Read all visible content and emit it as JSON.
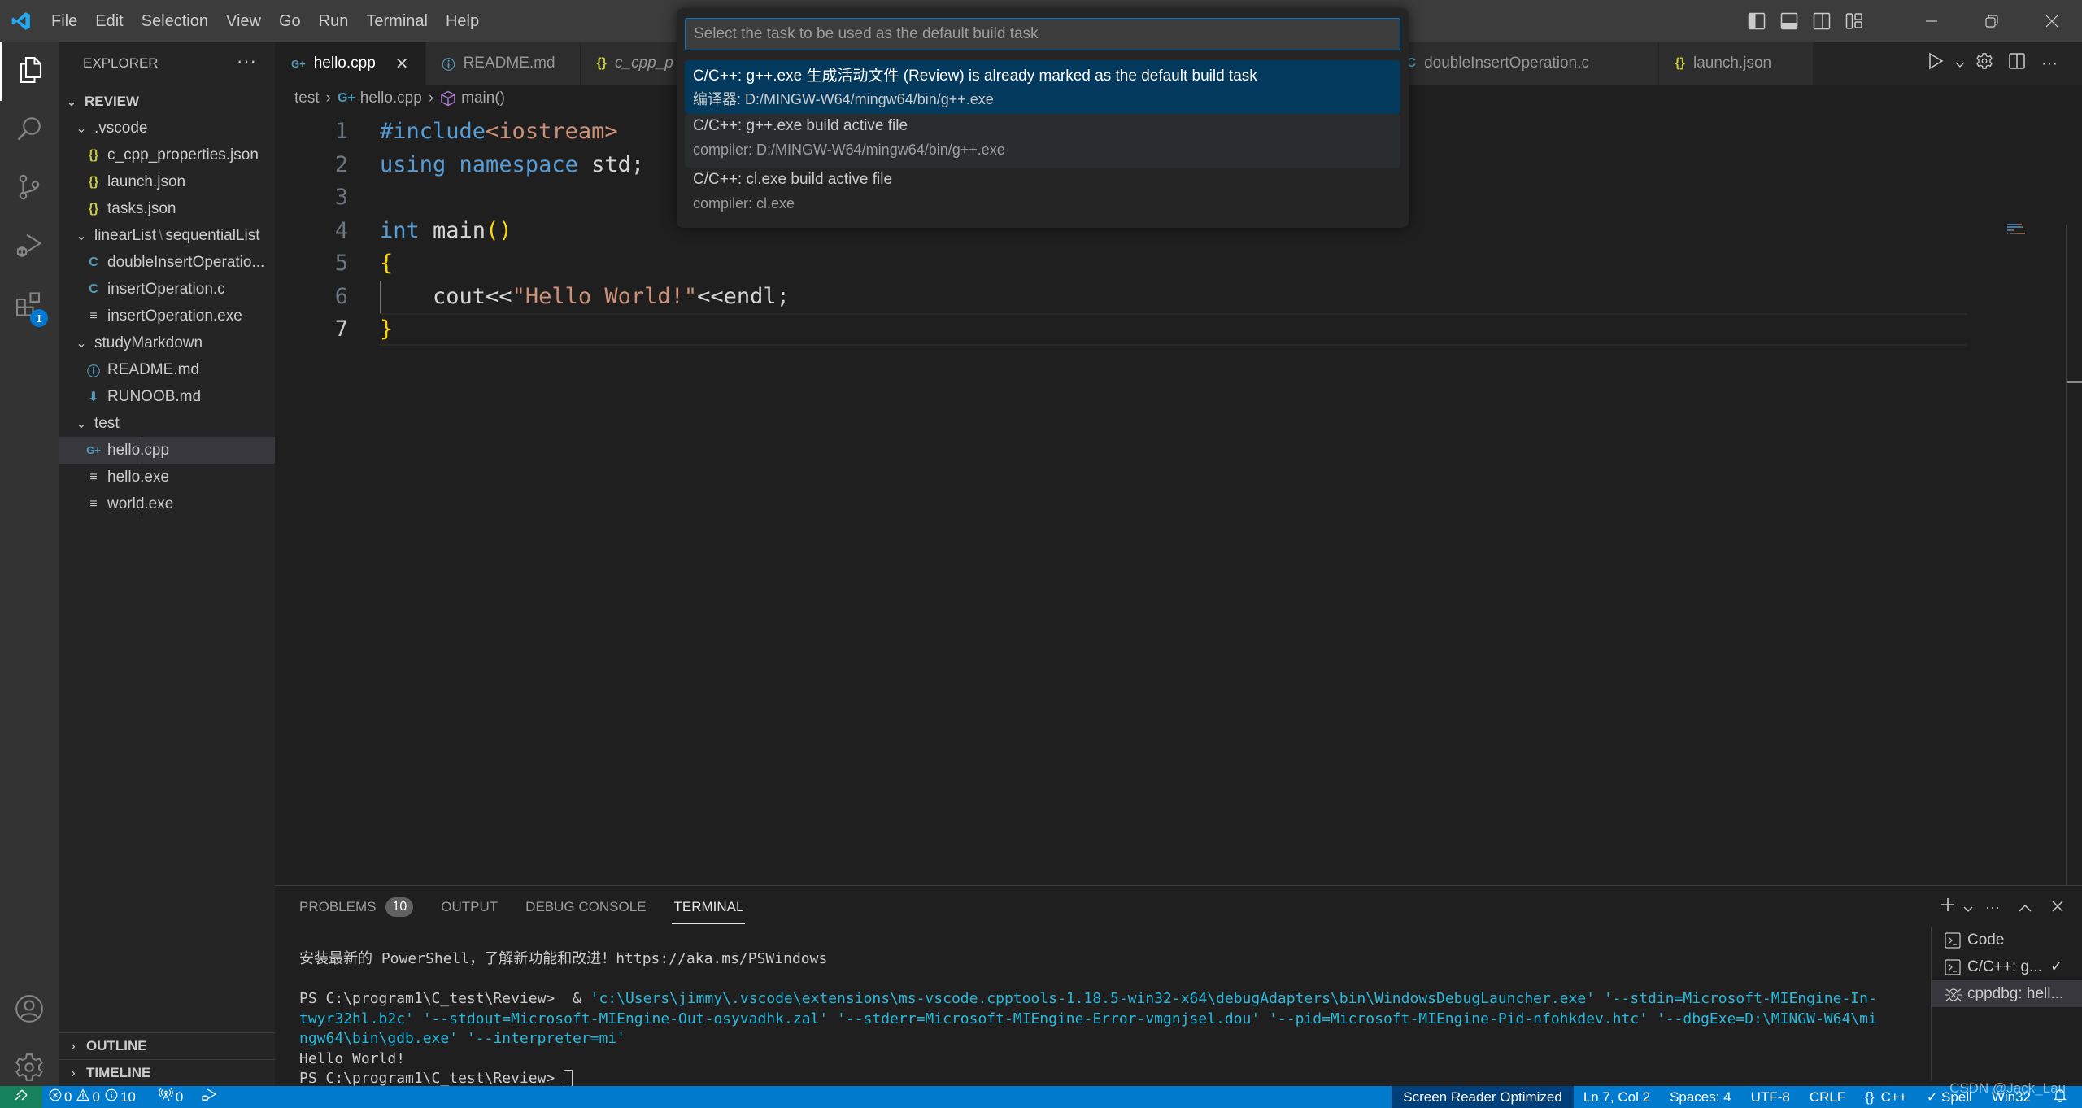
{
  "titlebar": {
    "menu": [
      "File",
      "Edit",
      "Selection",
      "View",
      "Go",
      "Run",
      "Terminal",
      "Help"
    ]
  },
  "activitybar": {
    "items": [
      {
        "name": "explorer",
        "icon": "files-icon"
      },
      {
        "name": "search",
        "icon": "search-icon"
      },
      {
        "name": "source-control",
        "icon": "source-control-icon"
      },
      {
        "name": "run-debug",
        "icon": "run-debug-icon"
      },
      {
        "name": "extensions",
        "icon": "extensions-icon",
        "badge": "1"
      }
    ],
    "bottom": [
      {
        "name": "accounts",
        "icon": "account-icon"
      },
      {
        "name": "manage",
        "icon": "gear-icon"
      }
    ]
  },
  "sidebar": {
    "title": "EXPLORER",
    "more": "···",
    "root": "REVIEW",
    "tree": [
      {
        "label": ".vscode",
        "type": "folder",
        "depth": 1
      },
      {
        "label": "c_cpp_properties.json",
        "type": "json",
        "depth": 2
      },
      {
        "label": "launch.json",
        "type": "json",
        "depth": 2
      },
      {
        "label": "tasks.json",
        "type": "json",
        "depth": 2
      },
      {
        "label": "linearList",
        "label2": "sequentialList",
        "type": "folder",
        "depth": 1
      },
      {
        "label": "doubleInsertOperatio...",
        "type": "c",
        "depth": 2
      },
      {
        "label": "insertOperation.c",
        "type": "c",
        "depth": 2
      },
      {
        "label": "insertOperation.exe",
        "type": "exe",
        "depth": 2
      },
      {
        "label": "studyMarkdown",
        "type": "folder",
        "depth": 1
      },
      {
        "label": "README.md",
        "type": "info",
        "depth": 2
      },
      {
        "label": "RUNOOB.md",
        "type": "md",
        "depth": 2
      },
      {
        "label": "test",
        "type": "folder",
        "depth": 1
      },
      {
        "label": "hello.cpp",
        "type": "cpp",
        "depth": 2,
        "selected": true
      },
      {
        "label": "hello.exe",
        "type": "exe",
        "depth": 2
      },
      {
        "label": "world.exe",
        "type": "exe",
        "depth": 2
      }
    ],
    "sections": [
      "OUTLINE",
      "TIMELINE"
    ]
  },
  "tabs": [
    {
      "label": "hello.cpp",
      "type": "cpp",
      "active": true,
      "close": "✕"
    },
    {
      "label": "README.md",
      "type": "info"
    },
    {
      "label": "c_cpp_p",
      "type": "json",
      "italic": true
    },
    {
      "label": "doubleInsertOperation.c",
      "type": "c"
    },
    {
      "label": "launch.json",
      "type": "json"
    }
  ],
  "breadcrumb": {
    "folder": "test",
    "file": "hello.cpp",
    "symbol": "main()"
  },
  "editor": {
    "lines": [
      {
        "n": "1",
        "tokens": [
          [
            "kw",
            "#include"
          ],
          [
            "str",
            "<iostream>"
          ]
        ]
      },
      {
        "n": "2",
        "tokens": [
          [
            "kw",
            "using"
          ],
          [
            "id",
            " "
          ],
          [
            "kw",
            "namespace"
          ],
          [
            "id",
            " std;"
          ]
        ]
      },
      {
        "n": "3",
        "tokens": []
      },
      {
        "n": "4",
        "tokens": [
          [
            "kw",
            "int"
          ],
          [
            "id",
            " main"
          ],
          [
            "br",
            "()"
          ]
        ]
      },
      {
        "n": "5",
        "tokens": [
          [
            "br",
            "{"
          ]
        ]
      },
      {
        "n": "6",
        "tokens": [
          [
            "id",
            "    cout<<"
          ],
          [
            "str",
            "\"Hello World!\""
          ],
          [
            "id",
            "<<endl;"
          ]
        ]
      },
      {
        "n": "7",
        "tokens": [
          [
            "br",
            "}"
          ]
        ],
        "current": true
      }
    ]
  },
  "palette": {
    "placeholder": "Select the task to be used as the default build task",
    "value": "",
    "items": [
      {
        "label": "C/C++: g++.exe 生成活动文件 (Review) is already marked as the default build task",
        "detail": "编译器: D:/MINGW-W64/mingw64/bin/g++.exe",
        "state": "focused"
      },
      {
        "label": "C/C++: g++.exe build active file",
        "detail": "compiler: D:/MINGW-W64/mingw64/bin/g++.exe",
        "state": "hover"
      },
      {
        "label": "C/C++: cl.exe build active file",
        "detail": "compiler: cl.exe",
        "state": ""
      }
    ]
  },
  "panel": {
    "tabs": [
      {
        "label": "PROBLEMS",
        "badge": "10"
      },
      {
        "label": "OUTPUT"
      },
      {
        "label": "DEBUG CONSOLE"
      },
      {
        "label": "TERMINAL",
        "active": true
      }
    ],
    "terminal": {
      "line1": "安装最新的 PowerShell，了解新功能和改进！https://aka.ms/PSWindows",
      "prompt": "PS C:\\program1\\C_test\\Review> ",
      "cmd_amp": " & ",
      "cmd_1": "'c:\\Users\\jimmy\\.vscode\\extensions\\ms-vscode.cpptools-1.18.5-win32-x64\\debugAdapters\\bin\\WindowsDebugLauncher.exe' '--stdin=Microsoft-MIEngine-In-",
      "cmd_2": "twyr32hl.b2c' '--stdout=Microsoft-MIEngine-Out-osyvadhk.zal' '--stderr=Microsoft-MIEngine-Error-vmgnjsel.dou' '--pid=Microsoft-MIEngine-Pid-nfohkdev.htc' '--dbgExe=D:\\MINGW-W64\\mi",
      "cmd_3": "ngw64\\bin\\gdb.exe' '--interpreter=mi'",
      "output": "Hello World!",
      "prompt2": "PS C:\\program1\\C_test\\Review> "
    },
    "terminals": [
      {
        "label": "Code",
        "icon": "terminal-icon"
      },
      {
        "label": "C/C++: g...",
        "icon": "terminal-icon",
        "check": "✓"
      },
      {
        "label": "cppdbg: hell...",
        "icon": "debug-icon",
        "selected": true
      }
    ]
  },
  "statusbar": {
    "errors": "0",
    "warnings": "0",
    "infos": "10",
    "ports": "0",
    "screen_reader": "Screen Reader Optimized",
    "position": "Ln 7, Col 2",
    "spaces": "Spaces: 4",
    "encoding": "UTF-8",
    "eol": "CRLF",
    "language": "C++",
    "spell": "Spell",
    "platform": "Win32",
    "watermark": "CSDN @Jack_Lau"
  },
  "colors": {
    "accent": "#007acc",
    "remote": "#16825d",
    "focus_item": "#04395e",
    "keyword": "#569cd6",
    "string": "#ce9178",
    "bracket": "#ffd700"
  }
}
